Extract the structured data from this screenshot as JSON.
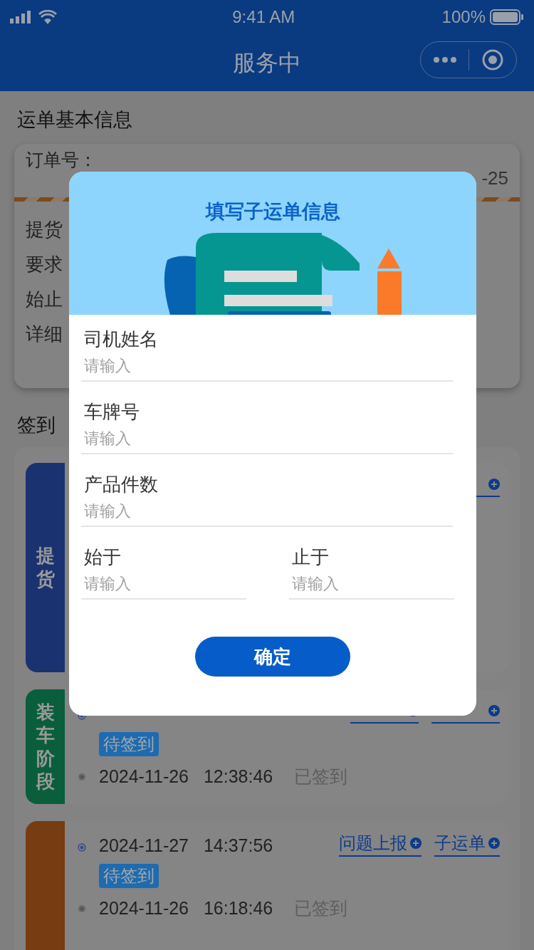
{
  "status_bar": {
    "time": "9:41 AM",
    "battery": "100%"
  },
  "nav": {
    "title": "服务中"
  },
  "basic_info": {
    "heading": "运单基本信息",
    "order_label": "订单号：",
    "date_tail": "-25",
    "rows": [
      "提货",
      "要求",
      "始止",
      "详细"
    ]
  },
  "checkin": {
    "heading": "签到"
  },
  "stages": [
    {
      "tag": "提货",
      "color": "#1b3270",
      "links": [
        {
          "kind": "covered"
        }
      ]
    },
    {
      "tag": "装车阶段",
      "color": "#0a5e3c",
      "first_dot": true,
      "links": [
        {
          "kind": "covered"
        },
        {
          "kind": "covered"
        }
      ],
      "entries": [
        {
          "kind": "badge",
          "text": "待签到"
        },
        {
          "kind": "signed",
          "date": "2024-11-26",
          "time": "12:38:46",
          "status": "已签到"
        }
      ]
    },
    {
      "color": "#773c12",
      "first_dot": true,
      "top": {
        "date": "2024-11-27",
        "time": "14:37:56"
      },
      "links": [
        {
          "kind": "text",
          "label": "问题上报"
        },
        {
          "kind": "text",
          "label": "子运单"
        }
      ],
      "entries": [
        {
          "kind": "badge",
          "text": "待签到"
        },
        {
          "kind": "signed",
          "date": "2024-11-26",
          "time": "16:18:46",
          "status": "已签到"
        }
      ]
    }
  ],
  "dialog": {
    "title": "填写子运单信息",
    "fields": [
      {
        "label": "司机姓名",
        "placeholder": "请输入"
      },
      {
        "label": "车牌号",
        "placeholder": "请输入"
      },
      {
        "label": "产品件数",
        "placeholder": "请输入"
      }
    ],
    "pair": [
      {
        "label": "始于",
        "placeholder": "请输入"
      },
      {
        "label": "止于",
        "placeholder": "请输入"
      }
    ],
    "confirm": "确定"
  }
}
